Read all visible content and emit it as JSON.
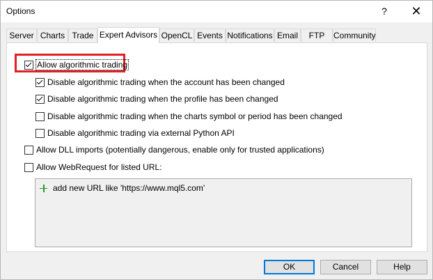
{
  "window": {
    "title": "Options",
    "help_glyph": "?",
    "close_glyph": "✕"
  },
  "tabs": [
    {
      "label": "Server"
    },
    {
      "label": "Charts"
    },
    {
      "label": "Trade"
    },
    {
      "label": "Expert Advisors"
    },
    {
      "label": "OpenCL"
    },
    {
      "label": "Events"
    },
    {
      "label": "Notifications"
    },
    {
      "label": "Email"
    },
    {
      "label": "FTP"
    },
    {
      "label": "Community"
    }
  ],
  "active_tab": "Expert Advisors",
  "options": {
    "allow_algo": {
      "label": "Allow algorithmic trading",
      "checked": true
    },
    "disable_account": {
      "label": "Disable algorithmic trading when the account has been changed",
      "checked": true
    },
    "disable_profile": {
      "label": "Disable algorithmic trading when the profile has been changed",
      "checked": true
    },
    "disable_symbol": {
      "label": "Disable algorithmic trading when the charts symbol or period has been changed",
      "checked": false
    },
    "disable_python": {
      "label": "Disable algorithmic trading via external Python API",
      "checked": false
    },
    "allow_dll": {
      "label": "Allow DLL imports (potentially dangerous, enable only for trusted applications)",
      "checked": false
    },
    "allow_webrequest": {
      "label": "Allow WebRequest for listed URL:",
      "checked": false
    }
  },
  "url_list": {
    "add_label": "add new URL like 'https://www.mql5.com'"
  },
  "buttons": {
    "ok": "OK",
    "cancel": "Cancel",
    "help": "Help"
  },
  "colors": {
    "highlight": "#e31e24",
    "plus_icon": "#1a9e1a",
    "default_button_border": "#0078d7"
  }
}
